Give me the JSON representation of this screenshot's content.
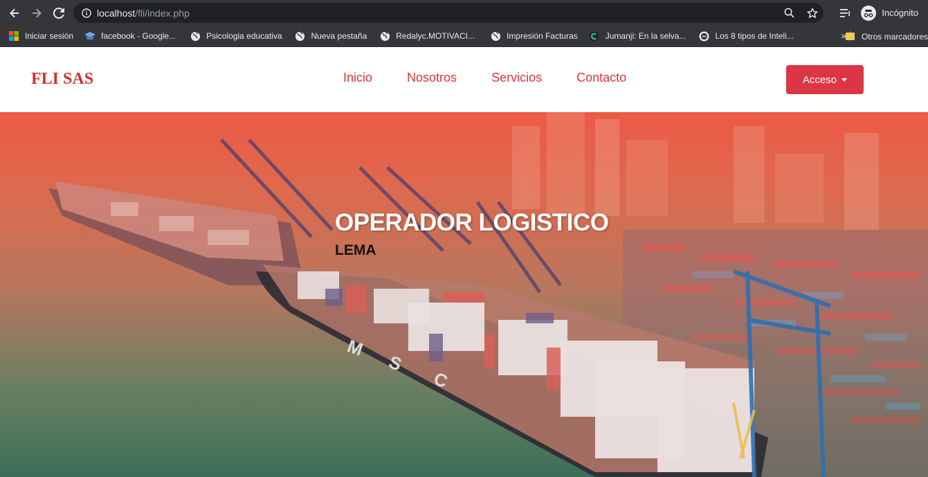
{
  "browser": {
    "url_host": "localhost",
    "url_path": "/fli/index.php",
    "profile_label": "Incógnito"
  },
  "bookmarks": {
    "items": [
      {
        "label": "Iniciar sesión",
        "icon": "microsoft-icon"
      },
      {
        "label": "facebook - Google...",
        "icon": "graduation-cap-icon"
      },
      {
        "label": "Psicologia educativa",
        "icon": "globe-icon"
      },
      {
        "label": "Nueva pestaña",
        "icon": "globe-icon"
      },
      {
        "label": "Redalyc.MOTIVACI...",
        "icon": "globe-icon"
      },
      {
        "label": "Impresión Facturas",
        "icon": "globe-icon"
      },
      {
        "label": "Jumanji: En la selva...",
        "icon": "c-logo-icon"
      },
      {
        "label": "Los 8 tipos de Inteli...",
        "icon": "e-logo-icon"
      }
    ],
    "more": "»",
    "other_label": "Otros marcadores"
  },
  "site": {
    "brand": "FLI SAS",
    "menu": [
      "Inicio",
      "Nosotros",
      "Servicios",
      "Contacto"
    ],
    "access_button": "Acceso",
    "accent_color": "#dc3545"
  },
  "hero": {
    "title": "OPERADOR LOGISTICO",
    "subtitle": "LEMA"
  }
}
